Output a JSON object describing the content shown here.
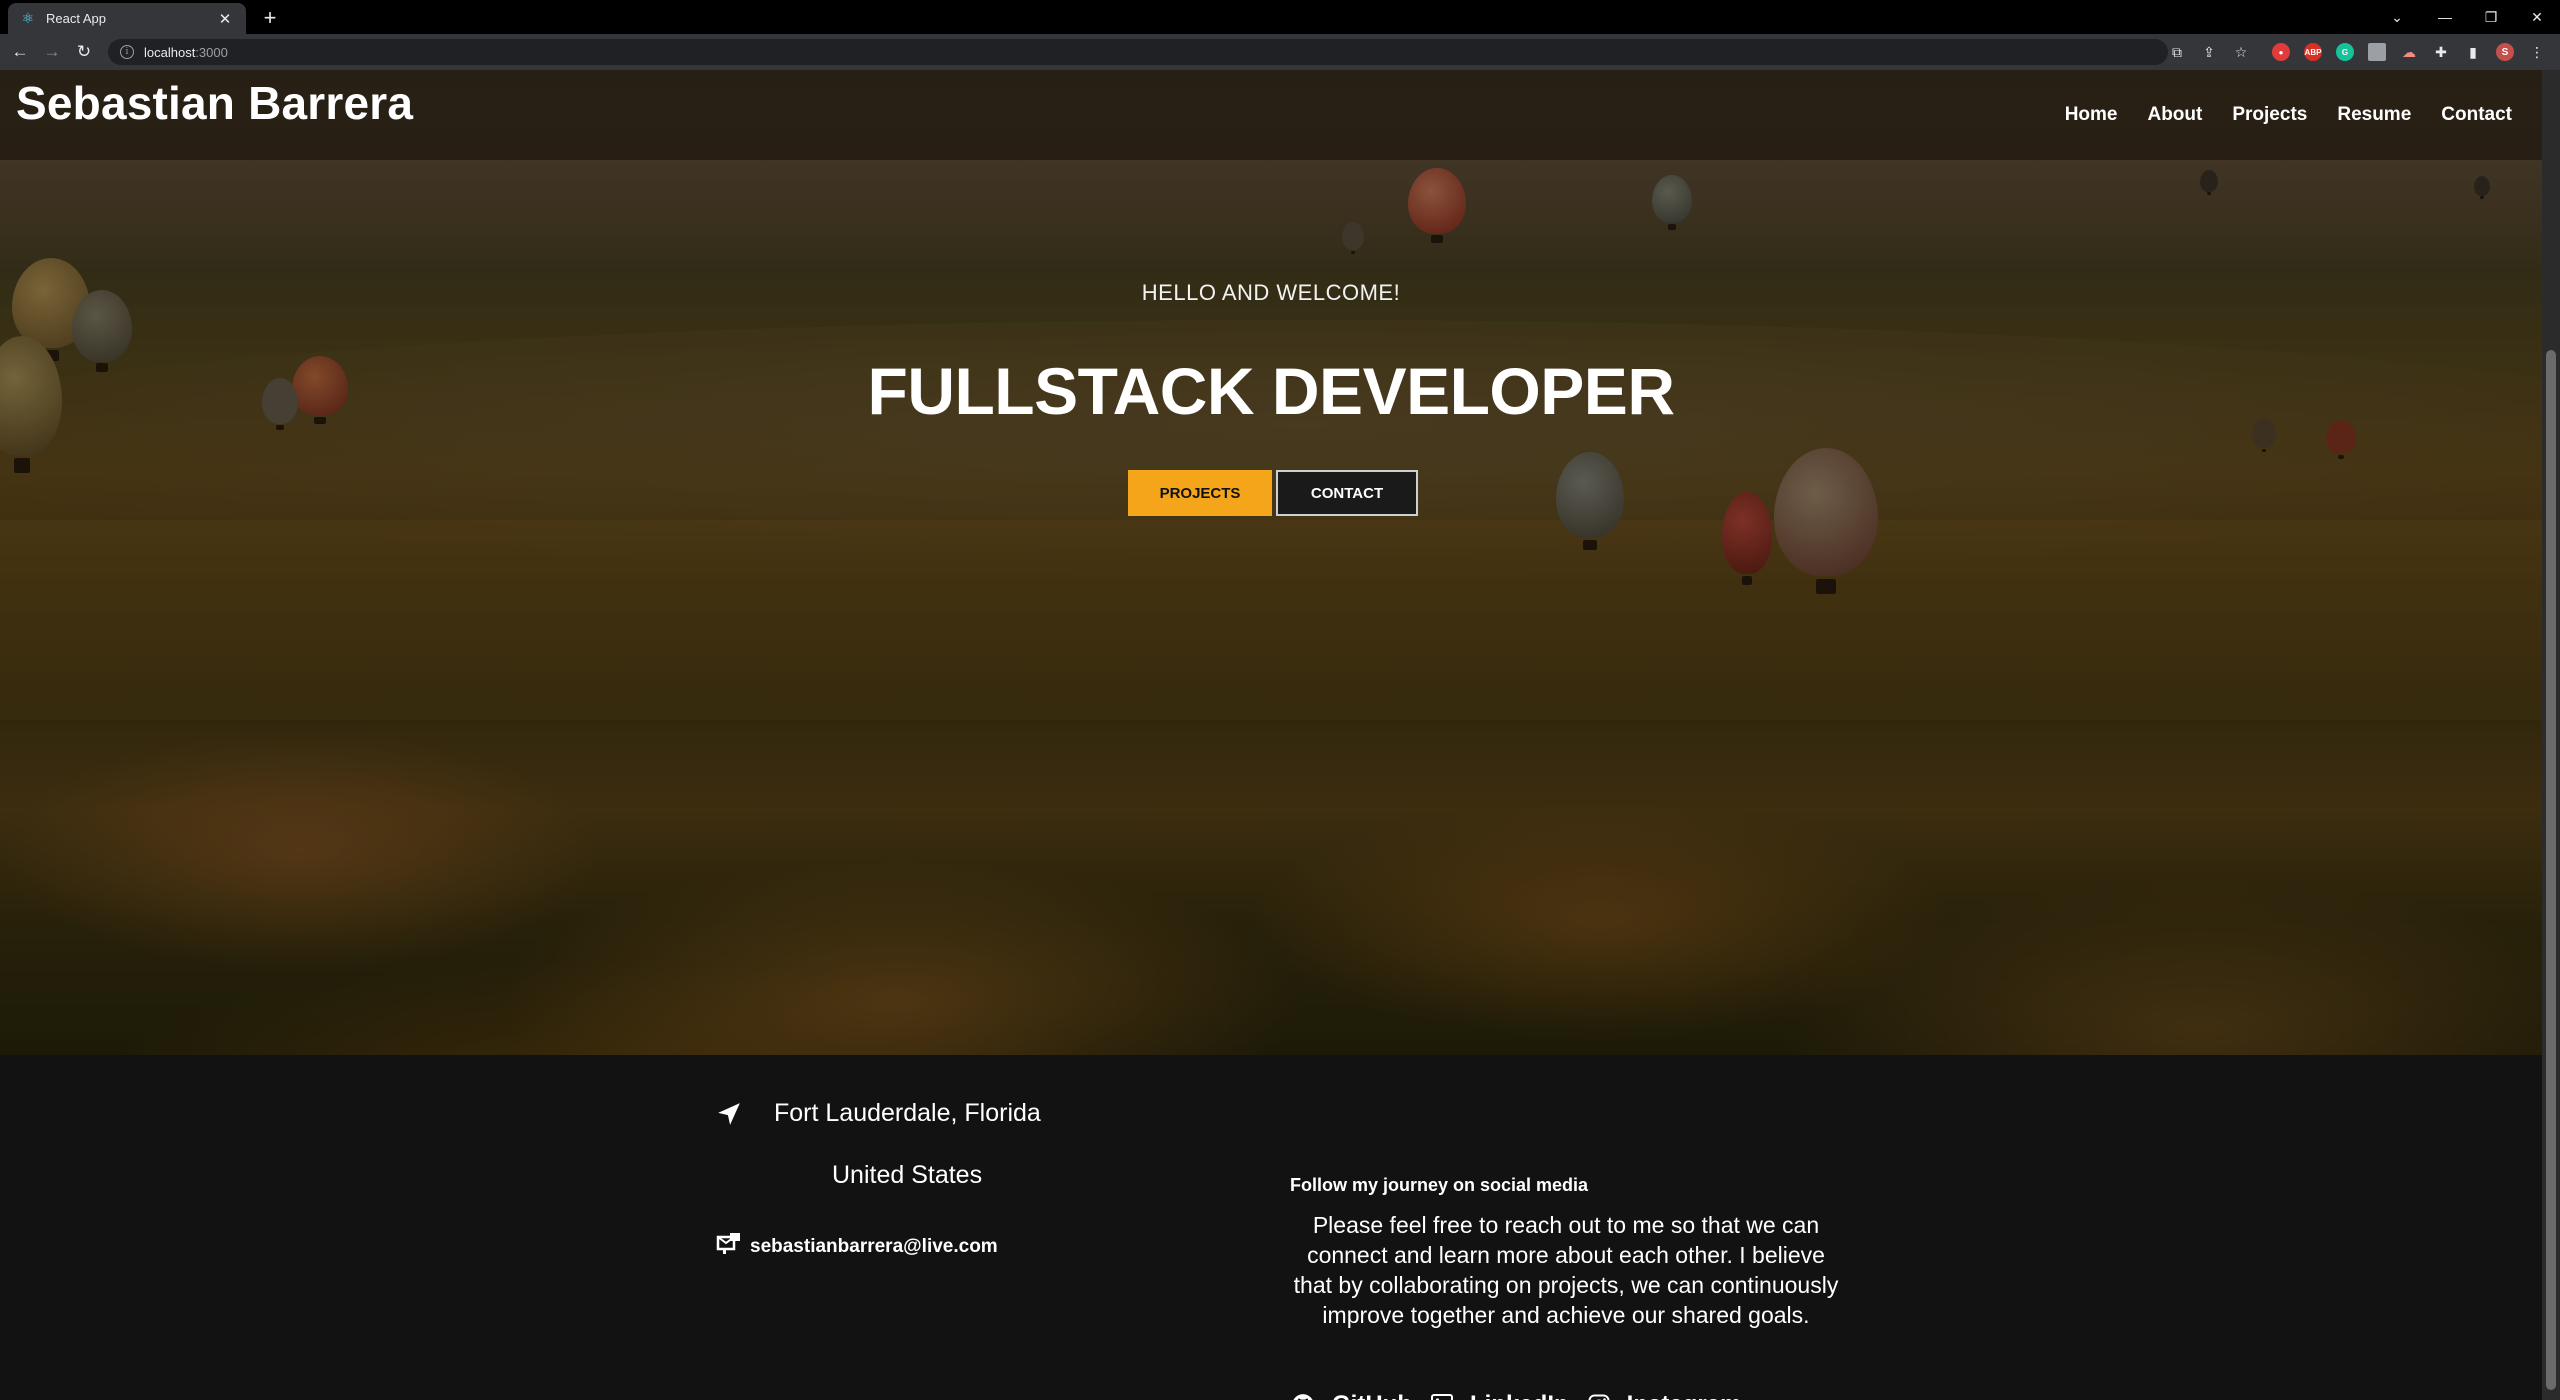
{
  "browser": {
    "tab_title": "React App",
    "url_host": "localhost",
    "url_port": ":3000"
  },
  "site": {
    "brand": "Sebastian Barrera",
    "nav": [
      "Home",
      "About",
      "Projects",
      "Resume",
      "Contact"
    ]
  },
  "hero": {
    "welcome": "HELLO AND WELCOME!",
    "headline": "FULLSTACK DEVELOPER",
    "primary_button": "PROJECTS",
    "secondary_button": "CONTACT"
  },
  "footer": {
    "city": "Fort Lauderdale, Florida",
    "country": "United States",
    "email": "sebastianbarrera@live.com",
    "follow_heading": "Follow my journey on social media",
    "about": "Please feel free to reach out to me so that we can connect and learn more about each other. I believe that by collaborating on projects, we can continuously improve together and achieve our shared goals.",
    "socials": [
      "GitHub",
      "LinkedIn",
      "Instagram"
    ]
  },
  "colors": {
    "accent": "#f4a519",
    "footer_bg": "#121212"
  }
}
